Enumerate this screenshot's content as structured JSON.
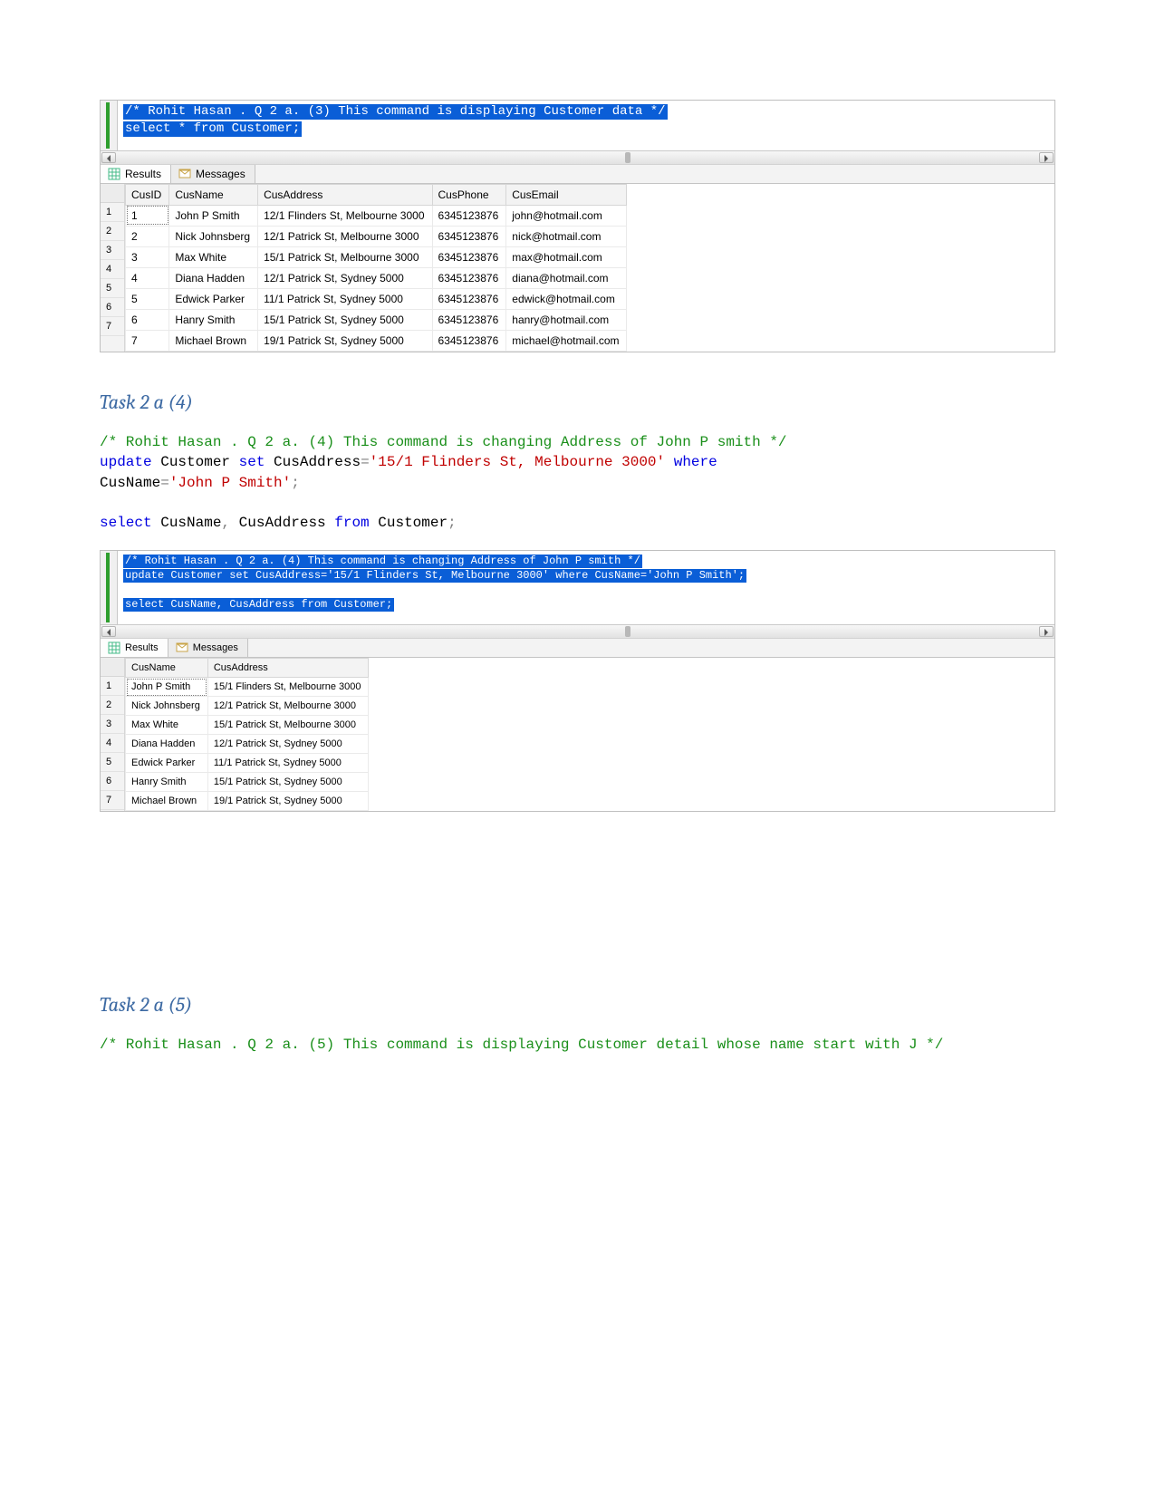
{
  "tabs": {
    "results": "Results",
    "messages": "Messages"
  },
  "ssms1": {
    "editor_line1": "/* Rohit Hasan . Q 2 a. (3) This command is displaying Customer data */",
    "editor_line2": "select * from Customer;",
    "columns": [
      "CusID",
      "CusName",
      "CusAddress",
      "CusPhone",
      "CusEmail"
    ],
    "rows": [
      [
        "1",
        "John P Smith",
        "12/1 Flinders St, Melbourne 3000",
        "6345123876",
        "john@hotmail.com"
      ],
      [
        "2",
        "Nick Johnsberg",
        "12/1 Patrick St, Melbourne 3000",
        "6345123876",
        "nick@hotmail.com"
      ],
      [
        "3",
        "Max White",
        "15/1 Patrick St, Melbourne 3000",
        "6345123876",
        "max@hotmail.com"
      ],
      [
        "4",
        "Diana Hadden",
        "12/1 Patrick St, Sydney 5000",
        "6345123876",
        "diana@hotmail.com"
      ],
      [
        "5",
        "Edwick Parker",
        "11/1 Patrick St, Sydney 5000",
        "6345123876",
        "edwick@hotmail.com"
      ],
      [
        "6",
        "Hanry Smith",
        "15/1 Patrick St, Sydney 5000",
        "6345123876",
        "hanry@hotmail.com"
      ],
      [
        "7",
        "Michael Brown",
        "19/1 Patrick St, Sydney 5000",
        "6345123876",
        "michael@hotmail.com"
      ]
    ]
  },
  "task2a4": {
    "heading": "Task 2 a (4)",
    "comment": "/* Rohit Hasan . Q 2 a. (4) This command is changing Address of John P smith */",
    "kw_update": "update",
    "tbl": " Customer ",
    "kw_set": "set",
    "col_eq": " CusAddress",
    "eq": "=",
    "str1": "'15/1 Flinders St, Melbourne 3000'",
    "kw_where": " where",
    "where_rest": "CusName",
    "str2": "'John P Smith'",
    "semi": ";",
    "sel_kw": "select",
    "sel_cols": " CusName",
    "comma": ",",
    "sel_col2": " CusAddress ",
    "kw_from": "from",
    "sel_tbl": " Customer",
    "semi2": ";"
  },
  "ssms2": {
    "editor_line1": "/* Rohit Hasan . Q 2 a. (4) This command is changing Address of John P smith */",
    "editor_line2": "update Customer set CusAddress='15/1 Flinders St, Melbourne 3000' where CusName='John P Smith';",
    "editor_line3": "select CusName, CusAddress from Customer;",
    "columns": [
      "CusName",
      "CusAddress"
    ],
    "rows": [
      [
        "John P Smith",
        "15/1 Flinders St, Melbourne 3000"
      ],
      [
        "Nick Johnsberg",
        "12/1 Patrick St, Melbourne 3000"
      ],
      [
        "Max White",
        "15/1 Patrick St, Melbourne 3000"
      ],
      [
        "Diana Hadden",
        "12/1 Patrick St, Sydney 5000"
      ],
      [
        "Edwick Parker",
        "11/1 Patrick St, Sydney 5000"
      ],
      [
        "Hanry Smith",
        "15/1 Patrick St, Sydney 5000"
      ],
      [
        "Michael Brown",
        "19/1 Patrick St, Sydney 5000"
      ]
    ]
  },
  "task2a5": {
    "heading": "Task 2 a (5)",
    "comment": "/* Rohit Hasan . Q 2 a. (5) This command is displaying Customer detail whose name start with J */"
  }
}
